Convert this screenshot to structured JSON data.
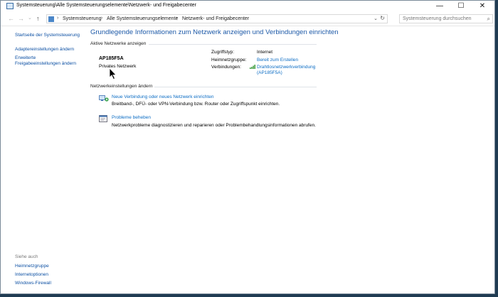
{
  "window": {
    "title": "Systemsteuerung\\Alle Systemsteuerungselemente\\Netzwerk- und Freigabecenter",
    "min": "—",
    "max": "☐",
    "close": "✕"
  },
  "nav": {
    "back": "←",
    "forward": "→",
    "recent": "⌄",
    "up": "↑",
    "breadcrumb": [
      "Systemsteuerung",
      "Alle Systemsteuerungselemente",
      "Netzwerk- und Freigabecenter"
    ],
    "separator": "›",
    "dropdown": "⌄",
    "refresh": "↻",
    "search_placeholder": "Systemsteuerung durchsuchen",
    "search_icon": "⌕"
  },
  "sidebar": {
    "links": [
      "Startseite der Systemsteuerung",
      "Adaptereinstellungen ändern",
      "Erweiterte",
      "Freigabeeinstellungen ändern"
    ],
    "see_also_heading": "Siehe auch",
    "see_also": [
      "Heimnetzgruppe",
      "Internetoptionen",
      "Windows-Firewall"
    ]
  },
  "main": {
    "title": "Grundlegende Informationen zum Netzwerk anzeigen und Verbindungen einrichten",
    "active_section": "Aktive Netzwerke anzeigen",
    "network_name": "AP185F5A",
    "network_type": "Privates Netzwerk",
    "access_type_label": "Zugriffstyp:",
    "access_type_value": "Internet",
    "homegroup_label": "Heimnetzgruppe:",
    "homegroup_value": "Bereit zum Erstellen",
    "connections_label": "Verbindungen:",
    "connection_line1": "Drahtlosnetzwerkverbindung",
    "connection_line2": "(AP185F5A)",
    "change_section": "Netzwerkeinstellungen ändern",
    "setup_link": "Neue Verbindung oder neues Netzwerk einrichten",
    "setup_desc": "Breitband-, DFÜ- oder VPN-Verbindung bzw. Router oder Zugriffspunkt einrichten.",
    "troubleshoot_link": "Probleme beheben",
    "troubleshoot_desc": "Netzwerkprobleme diagnostizieren und reparieren oder Problembehandlungsinformationen abrufen."
  },
  "colors": {
    "link": "#0b6cc4",
    "title": "#1e5aa8",
    "desktop": "#1f3b52"
  },
  "icons": [
    "window-icon",
    "control-panel-icon",
    "wifi-signal-icon",
    "network-setup-icon",
    "troubleshoot-icon",
    "mouse-cursor-icon"
  ]
}
